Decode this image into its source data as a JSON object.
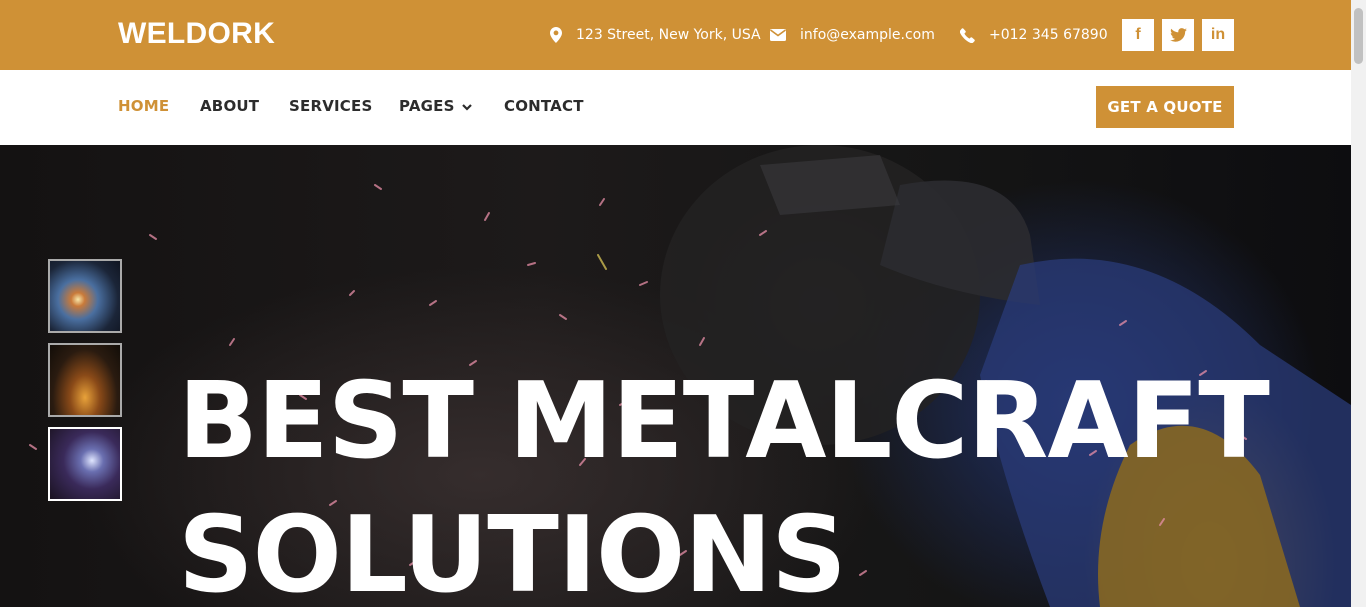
{
  "brand": {
    "name": "WELDORK"
  },
  "topbar": {
    "address": "123 Street, New York, USA",
    "email": "info@example.com",
    "phone": "+012 345 67890",
    "social": [
      {
        "icon": "facebook-icon",
        "glyph": "f"
      },
      {
        "icon": "twitter-icon",
        "glyph": "t"
      },
      {
        "icon": "linkedin-icon",
        "glyph": "in"
      }
    ]
  },
  "nav": {
    "items": [
      {
        "label": "HOME",
        "active": true
      },
      {
        "label": "ABOUT"
      },
      {
        "label": "SERVICES"
      },
      {
        "label": "PAGES",
        "dropdown": true
      },
      {
        "label": "CONTACT"
      }
    ],
    "cta": "GET A QUOTE"
  },
  "hero": {
    "headline_line1": "BEST METALCRAFT",
    "headline_line2": "SOLUTIONS",
    "active_slide": 3
  },
  "colors": {
    "accent": "#cf9136",
    "text_dark": "#2c2c2c",
    "white": "#ffffff"
  }
}
